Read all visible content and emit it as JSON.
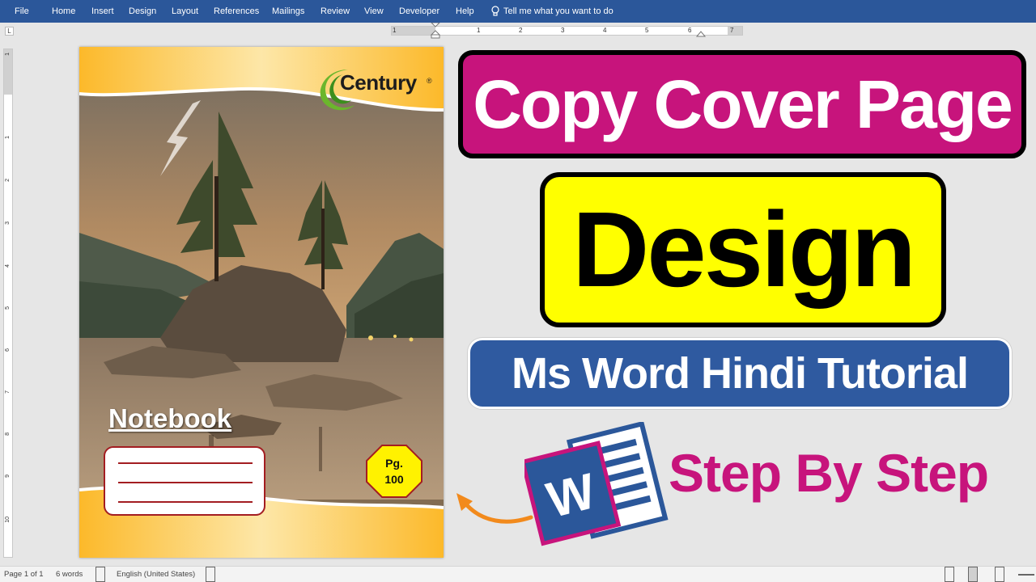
{
  "ribbon": {
    "tabs": [
      "File",
      "Home",
      "Insert",
      "Design",
      "Layout",
      "References",
      "Mailings",
      "Review",
      "View",
      "Developer",
      "Help"
    ],
    "tell_me": "Tell me what you want to do"
  },
  "ruler": {
    "tab_selector": "L",
    "h_labels": [
      "1",
      "1",
      "2",
      "3",
      "4",
      "5",
      "6",
      "7"
    ],
    "v_labels": [
      "1",
      "1",
      "2",
      "3",
      "4",
      "5",
      "6",
      "7",
      "8",
      "9",
      "10"
    ]
  },
  "cover": {
    "brand": "Century",
    "brand_mark": "®",
    "title": "Notebook",
    "pages_label": "Pg.",
    "pages_value": "100"
  },
  "thumbnail": {
    "line1": "Copy Cover Page",
    "line2": "Design",
    "line3": "Ms Word Hindi Tutorial",
    "line4": "Step By Step",
    "word_icon_letter": "W",
    "colors": {
      "magenta": "#c7147c",
      "yellow": "#ffff00",
      "blue": "#2f5aa0",
      "word_blue": "#2b579a"
    }
  },
  "statusbar": {
    "page": "Page 1 of 1",
    "words": "6 words",
    "language": "English (United States)"
  }
}
